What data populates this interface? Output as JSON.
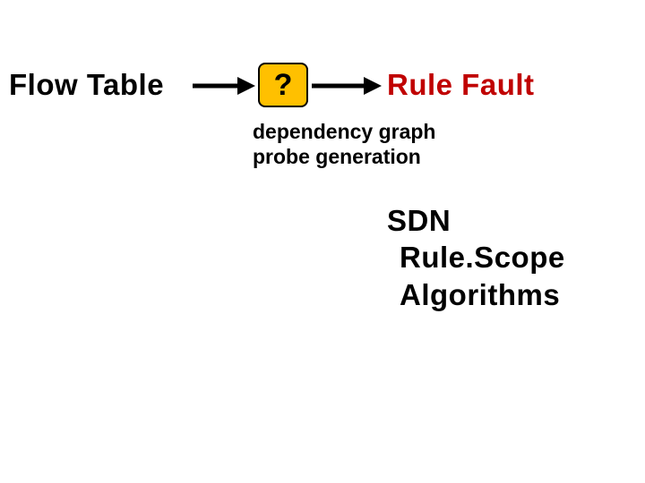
{
  "nodes": {
    "left": "Flow Table",
    "center": "?",
    "right": "Rule Fault"
  },
  "subtext": {
    "line1": "dependency graph",
    "line2": "probe generation"
  },
  "block": {
    "line1": "SDN",
    "line2": "Rule.Scope",
    "line3": "Algorithms"
  },
  "colors": {
    "accent_box": "#ffc000",
    "rule_fault": "#c00000"
  }
}
